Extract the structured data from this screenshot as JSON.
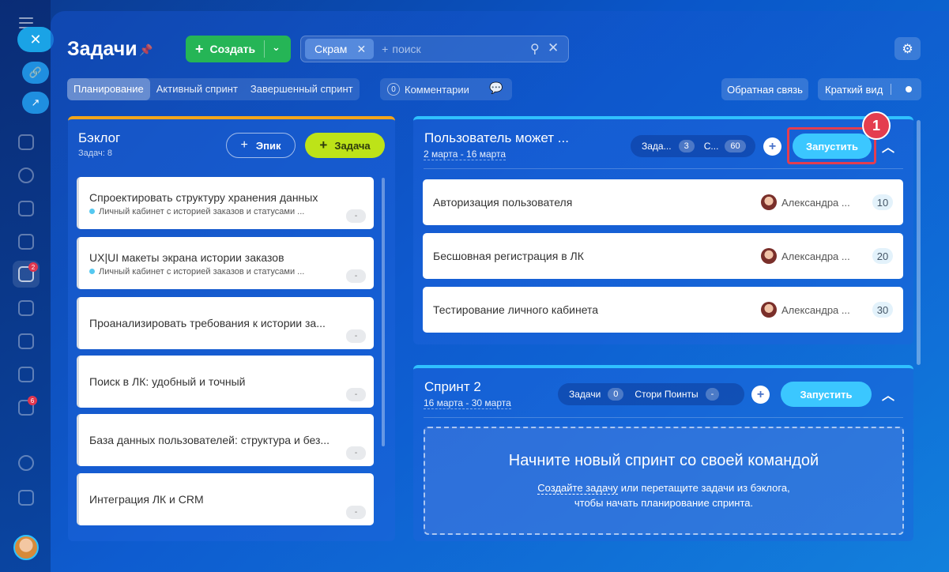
{
  "page": {
    "title": "Задачи"
  },
  "header": {
    "create_label": "Создать",
    "search_chip": "Скрам",
    "search_placeholder": "поиск"
  },
  "tabs": [
    {
      "label": "Планирование",
      "active": true
    },
    {
      "label": "Активный спринт",
      "active": false
    },
    {
      "label": "Завершенный спринт",
      "active": false
    }
  ],
  "comments": {
    "count": "0",
    "label": "Комментарии"
  },
  "feedback_label": "Обратная связь",
  "compact_label": "Краткий вид",
  "rail": {
    "badges": [
      "2",
      "6"
    ]
  },
  "backlog": {
    "title": "Бэклог",
    "subtitle": "Задач: 8",
    "epic_label": "Эпик",
    "task_label": "Задача",
    "cards": [
      {
        "title": "Спроектировать структуру хранения данных",
        "epic": "Личный кабинет с историей заказов и статусами ...",
        "points": "-"
      },
      {
        "title": "UX|UI макеты экрана истории заказов",
        "epic": "Личный кабинет с историей заказов и статусами ...",
        "points": "-"
      },
      {
        "title": "Проанализировать требования к истории за...",
        "epic": "",
        "points": "-"
      },
      {
        "title": "Поиск в ЛК: удобный и точный",
        "epic": "",
        "points": "-"
      },
      {
        "title": "База данных пользователей: структура и без...",
        "epic": "",
        "points": "-"
      },
      {
        "title": "Интеграция ЛК и CRM",
        "epic": "",
        "points": "-"
      }
    ]
  },
  "sprint1": {
    "title": "Пользователь может ...",
    "dates": "2 марта - 16 марта",
    "tasks_label": "Зада...",
    "tasks_count": "3",
    "points_label": "С...",
    "points_count": "60",
    "start_label": "Запустить",
    "callout": "1",
    "tasks": [
      {
        "title": "Авторизация пользователя",
        "assignee": "Александра ...",
        "points": "10"
      },
      {
        "title": "Бесшовная регистрация в ЛК",
        "assignee": "Александра ...",
        "points": "20"
      },
      {
        "title": "Тестирование личного кабинета",
        "assignee": "Александра ...",
        "points": "30"
      }
    ]
  },
  "sprint2": {
    "title": "Спринт 2",
    "dates": "16 марта - 30 марта",
    "tasks_label": "Задачи",
    "tasks_count": "0",
    "points_label": "Стори Поинты",
    "points_count": "-",
    "start_label": "Запустить",
    "empty_title": "Начните новый спринт со своей командой",
    "empty_link": "Создайте задачу",
    "empty_text_1": "или перетащите задачи из бэклога,",
    "empty_text_2": "чтобы начать планирование спринта."
  },
  "colors": {
    "create_green": "#25b556",
    "task_lime": "#bde318",
    "start_blue": "#3bc7ff",
    "backlog_accent": "#f2a51b",
    "sprint_accent": "#2fc1ff",
    "highlight_red": "#e43d4f"
  },
  "icons": [
    "menu-icon",
    "close-icon",
    "link-icon",
    "external-icon",
    "pin-icon",
    "search-icon",
    "clear-icon",
    "gear-icon",
    "chat-icon",
    "chevron-down-icon",
    "chevron-up-icon",
    "plus-icon"
  ]
}
